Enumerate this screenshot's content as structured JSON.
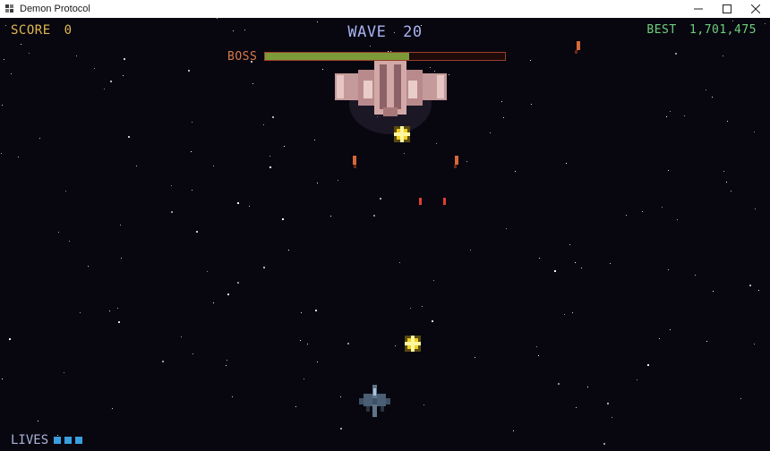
{
  "window": {
    "title": "Demon Protocol",
    "icon": "app-window-icon"
  },
  "hud": {
    "score_label": "SCORE",
    "score_value": "0",
    "wave_label": "WAVE",
    "wave_value": "20",
    "best_label": "BEST",
    "best_value": "1,701,475",
    "boss_label": "BOSS",
    "boss_health_fraction": 0.6,
    "lives_label": "LIVES",
    "lives_count": 3
  },
  "colors": {
    "score": "#e0b850",
    "wave": "#a9b3ef",
    "best": "#6fcf7c",
    "boss_label": "#d77a4c",
    "boss_bar_fill": "#7d9a38",
    "boss_bar_border": "#9a3f2c",
    "life_marker": "#3a9fe0",
    "powerup": "#f0d020",
    "background": "#080710"
  },
  "icons": [
    "minimize-icon",
    "maximize-icon",
    "close-icon"
  ]
}
